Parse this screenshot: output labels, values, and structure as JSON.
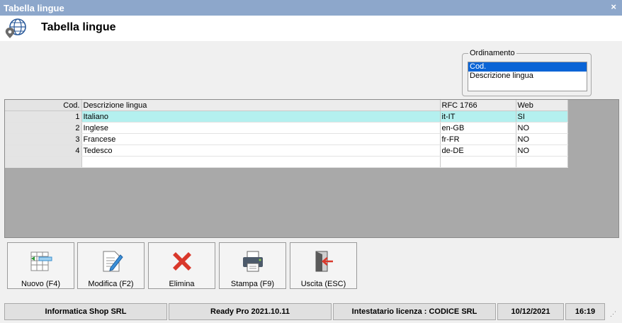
{
  "window": {
    "title": "Tabella lingue",
    "close_symbol": "×"
  },
  "header": {
    "title": "Tabella lingue",
    "icon": "globe-pin-icon"
  },
  "ordinamento": {
    "label": "Ordinamento",
    "options": [
      "Cod.",
      "Descrizione lingua"
    ],
    "selected": "Cod."
  },
  "table": {
    "columns": [
      "Cod.",
      "Descrizione lingua",
      "RFC 1766",
      "Web"
    ],
    "rows": [
      {
        "cod": "1",
        "descrizione": "Italiano",
        "rfc": "it-IT",
        "web": "SI"
      },
      {
        "cod": "2",
        "descrizione": "Inglese",
        "rfc": "en-GB",
        "web": "NO"
      },
      {
        "cod": "3",
        "descrizione": "Francese",
        "rfc": "fr-FR",
        "web": "NO"
      },
      {
        "cod": "4",
        "descrizione": "Tedesco",
        "rfc": "de-DE",
        "web": "NO"
      }
    ],
    "selected_row": 0,
    "selected_color": "#b4f0ef"
  },
  "toolbar": {
    "nuovo": "Nuovo (F4)",
    "modifica": "Modifica (F2)",
    "elimina": "Elimina",
    "stampa": "Stampa (F9)",
    "uscita": "Uscita (ESC)"
  },
  "status": {
    "company": "Informatica Shop SRL",
    "version": "Ready Pro 2021.10.11",
    "license": "Intestatario licenza : CODICE SRL",
    "date": "10/12/2021",
    "time": "16:19"
  }
}
